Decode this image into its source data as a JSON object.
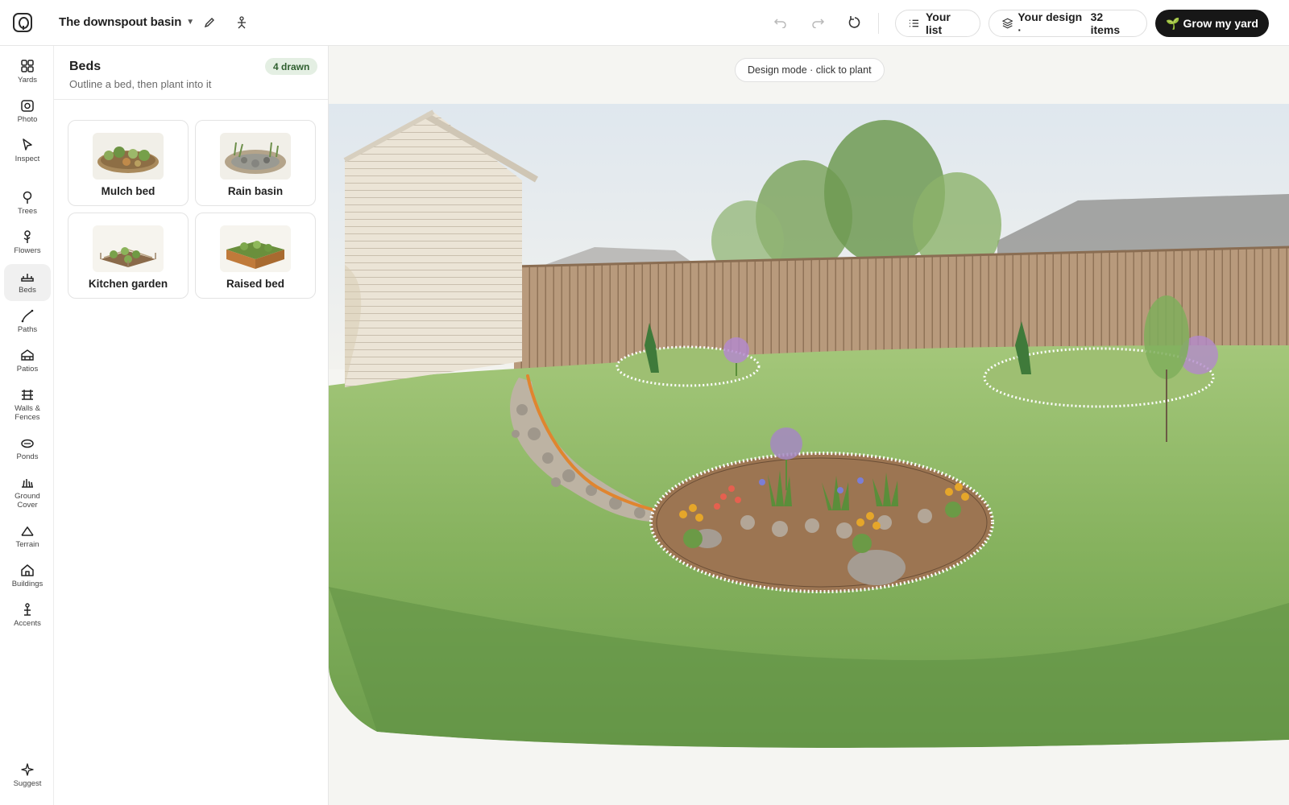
{
  "app": {
    "project_title": "The downspout basin"
  },
  "toolbar": {
    "your_list_label": "Your list",
    "your_design_label": "Your design ·",
    "your_design_count": "32 items",
    "grow_label": "Grow my yard"
  },
  "rail": {
    "items": [
      {
        "label": "Yards",
        "icon": "grid-icon"
      },
      {
        "label": "Photo",
        "icon": "camera-icon"
      },
      {
        "label": "Inspect",
        "icon": "cursor-icon"
      },
      {
        "label": "Trees",
        "icon": "tree-icon"
      },
      {
        "label": "Flowers",
        "icon": "flower-icon"
      },
      {
        "label": "Beds",
        "icon": "bed-icon"
      },
      {
        "label": "Paths",
        "icon": "path-icon"
      },
      {
        "label": "Patios",
        "icon": "patio-icon"
      },
      {
        "label": "Walls &",
        "label2": "Fences",
        "icon": "fence-icon"
      },
      {
        "label": "Ponds",
        "icon": "pond-icon"
      },
      {
        "label": "Ground",
        "label2": "Cover",
        "icon": "groundcover-icon"
      },
      {
        "label": "Terrain",
        "icon": "terrain-icon"
      },
      {
        "label": "Buildings",
        "icon": "house-icon"
      },
      {
        "label": "Accents",
        "icon": "accent-icon"
      }
    ],
    "suggest_label": "Suggest",
    "active": "Beds"
  },
  "panel": {
    "title": "Beds",
    "subtitle": "Outline a bed, then plant into it",
    "badge": "4 drawn",
    "cards": [
      {
        "label": "Mulch bed"
      },
      {
        "label": "Rain basin"
      },
      {
        "label": "Kitchen garden"
      },
      {
        "label": "Raised bed"
      }
    ]
  },
  "canvas": {
    "mode_text": "Design mode · click to plant"
  },
  "colors": {
    "accent_dark": "#171717",
    "badge_bg": "#e4efe3",
    "path_stroke": "#e0852f",
    "bed_outline": "#ffffff"
  }
}
